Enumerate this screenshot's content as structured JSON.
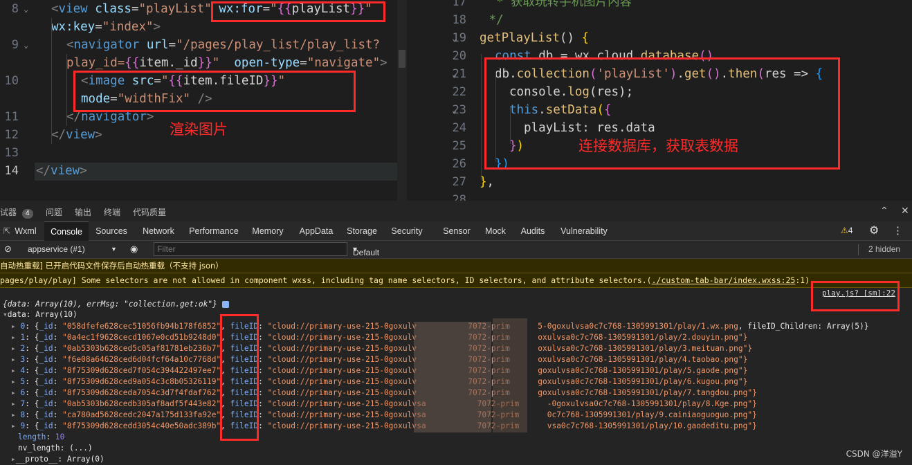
{
  "left_editor": {
    "lines": [
      {
        "num": "8",
        "fold": true,
        "segments": [
          {
            "t": "<",
            "c": "p"
          },
          {
            "t": "view",
            "c": "t"
          },
          {
            "t": " ",
            "c": "n"
          },
          {
            "t": "class",
            "c": "a"
          },
          {
            "t": "=",
            "c": "n"
          },
          {
            "t": "\"playList\"",
            "c": "s"
          },
          {
            "t": " ",
            "c": "n"
          },
          {
            "t": "wx:for",
            "c": "a"
          },
          {
            "t": "=",
            "c": "n"
          },
          {
            "t": "\"",
            "c": "s"
          },
          {
            "t": "{{",
            "c": "b2"
          },
          {
            "t": "playList",
            "c": "n"
          },
          {
            "t": "}}",
            "c": "b2"
          },
          {
            "t": "\"",
            "c": "s"
          }
        ]
      },
      {
        "num": "",
        "fold": false,
        "segments": [
          {
            "t": "wx:key",
            "c": "a"
          },
          {
            "t": "=",
            "c": "n"
          },
          {
            "t": "\"index\"",
            "c": "s"
          },
          {
            "t": ">",
            "c": "p"
          }
        ]
      },
      {
        "num": "9",
        "fold": true,
        "segments": [
          {
            "t": "<",
            "c": "p"
          },
          {
            "t": "navigator",
            "c": "t"
          },
          {
            "t": " ",
            "c": "n"
          },
          {
            "t": "url",
            "c": "a"
          },
          {
            "t": "=",
            "c": "n"
          },
          {
            "t": "\"/pages/play_list/play_list?",
            "c": "s"
          }
        ]
      },
      {
        "num": "",
        "fold": false,
        "segments": [
          {
            "t": "play_id=",
            "c": "s"
          },
          {
            "t": "{{",
            "c": "b2"
          },
          {
            "t": "item._id",
            "c": "n"
          },
          {
            "t": "}}",
            "c": "b2"
          },
          {
            "t": "\"",
            "c": "s"
          },
          {
            "t": "  ",
            "c": "n"
          },
          {
            "t": "open-type",
            "c": "a"
          },
          {
            "t": "=",
            "c": "n"
          },
          {
            "t": "\"navigate\"",
            "c": "s"
          },
          {
            "t": ">",
            "c": "p"
          }
        ]
      },
      {
        "num": "10",
        "fold": false,
        "segments": [
          {
            "t": "<",
            "c": "p"
          },
          {
            "t": "image",
            "c": "t"
          },
          {
            "t": " ",
            "c": "n"
          },
          {
            "t": "src",
            "c": "a"
          },
          {
            "t": "=",
            "c": "n"
          },
          {
            "t": "\"",
            "c": "s"
          },
          {
            "t": "{{",
            "c": "b2"
          },
          {
            "t": "item.fileID",
            "c": "n"
          },
          {
            "t": "}}",
            "c": "b2"
          },
          {
            "t": "\"",
            "c": "s"
          }
        ]
      },
      {
        "num": "",
        "fold": false,
        "segments": [
          {
            "t": "mode",
            "c": "a"
          },
          {
            "t": "=",
            "c": "n"
          },
          {
            "t": "\"widthFix\"",
            "c": "s"
          },
          {
            "t": " ",
            "c": "n"
          },
          {
            "t": "/>",
            "c": "p"
          }
        ]
      },
      {
        "num": "11",
        "fold": false,
        "segments": [
          {
            "t": "</",
            "c": "p"
          },
          {
            "t": "navigator",
            "c": "t"
          },
          {
            "t": ">",
            "c": "p"
          }
        ]
      },
      {
        "num": "12",
        "fold": false,
        "segments": [
          {
            "t": "</",
            "c": "p"
          },
          {
            "t": "view",
            "c": "t"
          },
          {
            "t": ">",
            "c": "p"
          }
        ]
      },
      {
        "num": "13",
        "fold": false,
        "segments": []
      },
      {
        "num": "14",
        "fold": false,
        "segments": [
          {
            "t": "</",
            "c": "p"
          },
          {
            "t": "view",
            "c": "t"
          },
          {
            "t": ">",
            "c": "p"
          }
        ]
      }
    ],
    "annotation": "渲染图片"
  },
  "right_editor": {
    "lines": [
      {
        "num": "17",
        "fold": false,
        "segments": [
          {
            "t": "  * 获取玩转手机图片内容",
            "c": "cm"
          }
        ]
      },
      {
        "num": "18",
        "fold": false,
        "segments": [
          {
            "t": " */",
            "c": "cm"
          }
        ]
      },
      {
        "num": "19",
        "fold": true,
        "segments": [
          {
            "t": "getPlayList",
            "c": "y"
          },
          {
            "t": "() ",
            "c": "n"
          },
          {
            "t": "{",
            "c": "b"
          }
        ]
      },
      {
        "num": "20",
        "fold": false,
        "segments": [
          {
            "t": "const",
            "c": "t"
          },
          {
            "t": " db = wx.cloud.",
            "c": "n"
          },
          {
            "t": "database",
            "c": "y"
          },
          {
            "t": "()",
            "c": "b2"
          }
        ]
      },
      {
        "num": "21",
        "fold": true,
        "segments": [
          {
            "t": "db.",
            "c": "n"
          },
          {
            "t": "collection",
            "c": "y"
          },
          {
            "t": "(",
            "c": "b2"
          },
          {
            "t": "'playList'",
            "c": "s2"
          },
          {
            "t": ")",
            "c": "b2"
          },
          {
            "t": ".",
            "c": "n"
          },
          {
            "t": "get",
            "c": "y"
          },
          {
            "t": "()",
            "c": "b2"
          },
          {
            "t": ".",
            "c": "n"
          },
          {
            "t": "then",
            "c": "y"
          },
          {
            "t": "(",
            "c": "b2"
          },
          {
            "t": "res => ",
            "c": "n"
          },
          {
            "t": "{",
            "c": "b3"
          }
        ]
      },
      {
        "num": "22",
        "fold": false,
        "segments": [
          {
            "t": "console.",
            "c": "n"
          },
          {
            "t": "log",
            "c": "y"
          },
          {
            "t": "(res);",
            "c": "n"
          }
        ]
      },
      {
        "num": "23",
        "fold": true,
        "segments": [
          {
            "t": "this",
            "c": "t"
          },
          {
            "t": ".",
            "c": "n"
          },
          {
            "t": "setData",
            "c": "y"
          },
          {
            "t": "(",
            "c": "b"
          },
          {
            "t": "{",
            "c": "b2"
          }
        ]
      },
      {
        "num": "24",
        "fold": false,
        "segments": [
          {
            "t": "playList: res.data",
            "c": "n"
          }
        ]
      },
      {
        "num": "25",
        "fold": false,
        "segments": [
          {
            "t": "}",
            "c": "b2"
          },
          {
            "t": ")",
            "c": "b"
          }
        ]
      },
      {
        "num": "26",
        "fold": false,
        "segments": [
          {
            "t": "})",
            "c": "b3"
          }
        ]
      },
      {
        "num": "27",
        "fold": false,
        "segments": [
          {
            "t": "}",
            "c": "b"
          },
          {
            "t": ",",
            "c": "n"
          }
        ]
      },
      {
        "num": "28",
        "fold": false,
        "segments": []
      }
    ],
    "annotation": "连接数据库，获取表数据"
  },
  "devtools": {
    "panel_tabs": [
      {
        "label": "试器",
        "badge": "4"
      },
      {
        "label": "问题"
      },
      {
        "label": "输出"
      },
      {
        "label": "终端"
      },
      {
        "label": "代码质量"
      }
    ],
    "tabs": [
      "Wxml",
      "Console",
      "Sources",
      "Network",
      "Performance",
      "Memory",
      "AppData",
      "Storage",
      "Security",
      "Sensor",
      "Mock",
      "Audits",
      "Vulnerability"
    ],
    "selected_tab": "Console",
    "warn_count": "4",
    "context": "appservice (#1)",
    "filter_placeholder": "Filter",
    "levels": "Default levels",
    "hidden": "2 hidden",
    "warn1": "自动热重载] 已开启代码文件保存后自动热重载（不支持 json）",
    "warn2_pre": "pages/play/play] Some selectors are not allowed in component wxss, including tag name selectors, ID selectors, and attribute selectors.(",
    "warn2_link": "./custom-tab-bar/index.wxss:25",
    "warn2_post": ":1)",
    "source_link": "play.js? [sm]:22",
    "object_summary": "{data: Array(10), errMsg: \"collection.get:ok\"}",
    "data_label": "data: Array(10)",
    "rows": [
      {
        "idx": "0",
        "id": "058dfefe628cec51056fb94b178f6852",
        "path": "cloud://primary-use-215-0goxulv",
        "mid": "7072-prim",
        "tail": "5-0goxulvsa0c7c768-1305991301/play/1.wx.png",
        "extra": ", fileID_Children: Array(5)}"
      },
      {
        "idx": "1",
        "id": "0a4ec1f9628cecd1067e0cd51b9248d0",
        "path": "cloud://primary-use-215-0goxulv",
        "mid": "7072-prim",
        "tail": "oxulvsa0c7c768-1305991301/play/2.douyin.png\"}",
        "extra": ""
      },
      {
        "idx": "2",
        "id": "0ab5303b628ced5c05af81781eb236b7",
        "path": "cloud://primary-use-215-0goxulv",
        "mid": "7072-prim",
        "tail": "oxulvsa0c7c768-1305991301/play/3.meituan.png\"}",
        "extra": ""
      },
      {
        "idx": "3",
        "id": "f6e08a64628ced6d04fcf64a10c7768d",
        "path": "cloud://primary-use-215-0goxulv",
        "mid": "7072-prim",
        "tail": "oxulvsa0c7c768-1305991301/play/4.taobao.png\"}",
        "extra": ""
      },
      {
        "idx": "4",
        "id": "8f75309d628ced7f054c394422497ee7",
        "path": "cloud://primary-use-215-0goxulv",
        "mid": "7072-prim",
        "tail": "goxulvsa0c7c768-1305991301/play/5.gaode.png\"}",
        "extra": ""
      },
      {
        "idx": "5",
        "id": "8f75309d628ced9a054c3c8b05326119",
        "path": "cloud://primary-use-215-0goxulv",
        "mid": "7072-prim",
        "tail": "goxulvsa0c7c768-1305991301/play/6.kugou.png\"}",
        "extra": ""
      },
      {
        "idx": "6",
        "id": "8f75309d628ceda7054c3d7f4fdaf762",
        "path": "cloud://primary-use-215-0goxulv",
        "mid": "7072-prim",
        "tail": "goxulvsa0c7c768-1305991301/play/7.tangdou.png\"}",
        "extra": ""
      },
      {
        "idx": "7",
        "id": "0ab5303b628cedb305af8adf5f443e82",
        "path": "cloud://primary-use-215-0goxulvsa",
        "mid": "7072-prim",
        "tail": "-0goxulvsa0c7c768-1305991301/play/8.Kge.png\"}",
        "extra": ""
      },
      {
        "idx": "8",
        "id": "ca780ad5628cedc2047a175d133fa92e",
        "path": "cloud://primary-use-215-0goxulvsa",
        "mid": "7072-prim",
        "tail": "0c7c768-1305991301/play/9.cainiaoguoguo.png\"}",
        "extra": ""
      },
      {
        "idx": "9",
        "id": "8f75309d628cedd3054c40e50adc389b",
        "path": "cloud://primary-use-215-0goxulvsa",
        "mid": "7072-prim",
        "tail": "vsa0c7c768-1305991301/play/10.gaodeditu.png\"}",
        "extra": ""
      }
    ],
    "length_key": "length",
    "length_val": "10",
    "nv_length": "nv_length: (...)",
    "proto": "__proto__: Array(0)"
  },
  "watermark": "CSDN @洋溢Y",
  "colors": {
    "annotation_red": "#ff2b2b",
    "console_bg": "#242424",
    "warn_bg": "#332b00"
  }
}
